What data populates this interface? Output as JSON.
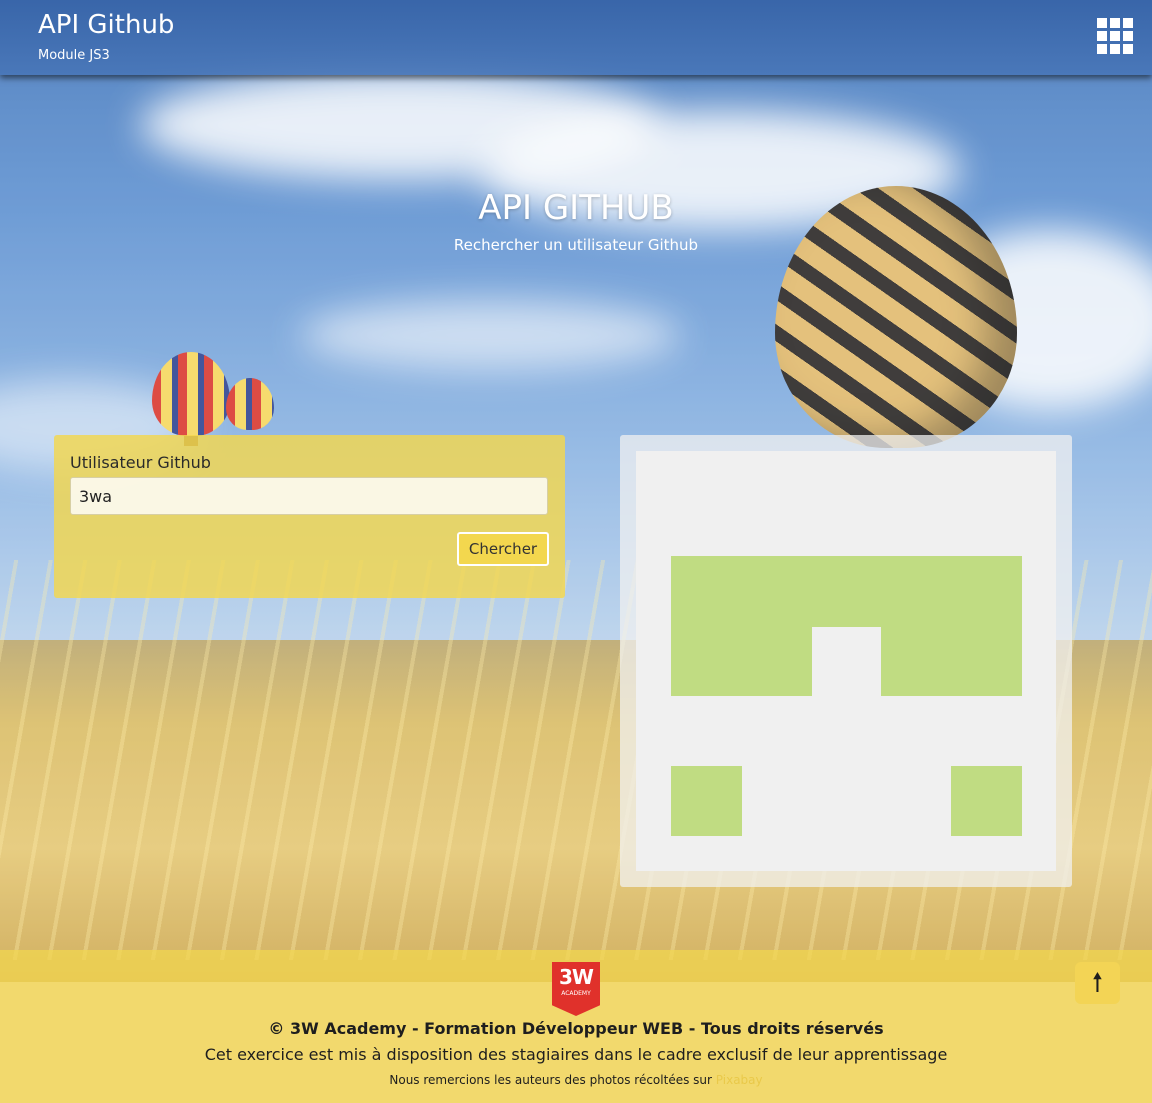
{
  "header": {
    "title": "API Github",
    "subtitle": "Module JS3",
    "menu_icon": "grid-icon"
  },
  "hero": {
    "title": "API GITHUB",
    "subtitle": "Rechercher un utilisateur Github"
  },
  "search": {
    "label": "Utilisateur Github",
    "value": "3wa",
    "button_label": "Chercher"
  },
  "result": {
    "avatar_icon": "identicon-avatar",
    "avatar_color": "#c0dc82",
    "avatar_background": "#f0f0f0"
  },
  "footer": {
    "logo_text": "3W",
    "logo_subtext": "ACADEMY",
    "copyright": "© 3W Academy - Formation Développeur WEB - Tous droits réservés",
    "notice": "Cet exercice est mis à disposition des stagiaires dans le cadre exclusif de leur apprentissage",
    "credits_text": "Nous remercions les auteurs des photos récoltées sur",
    "credits_link": "Pixabay",
    "back_to_top_icon": "arrow-up-icon",
    "back_to_top_glyph": "🠕"
  },
  "colors": {
    "header": "#3a68ab",
    "accent_yellow": "#f3d74e",
    "footer": "#f2d96d"
  }
}
